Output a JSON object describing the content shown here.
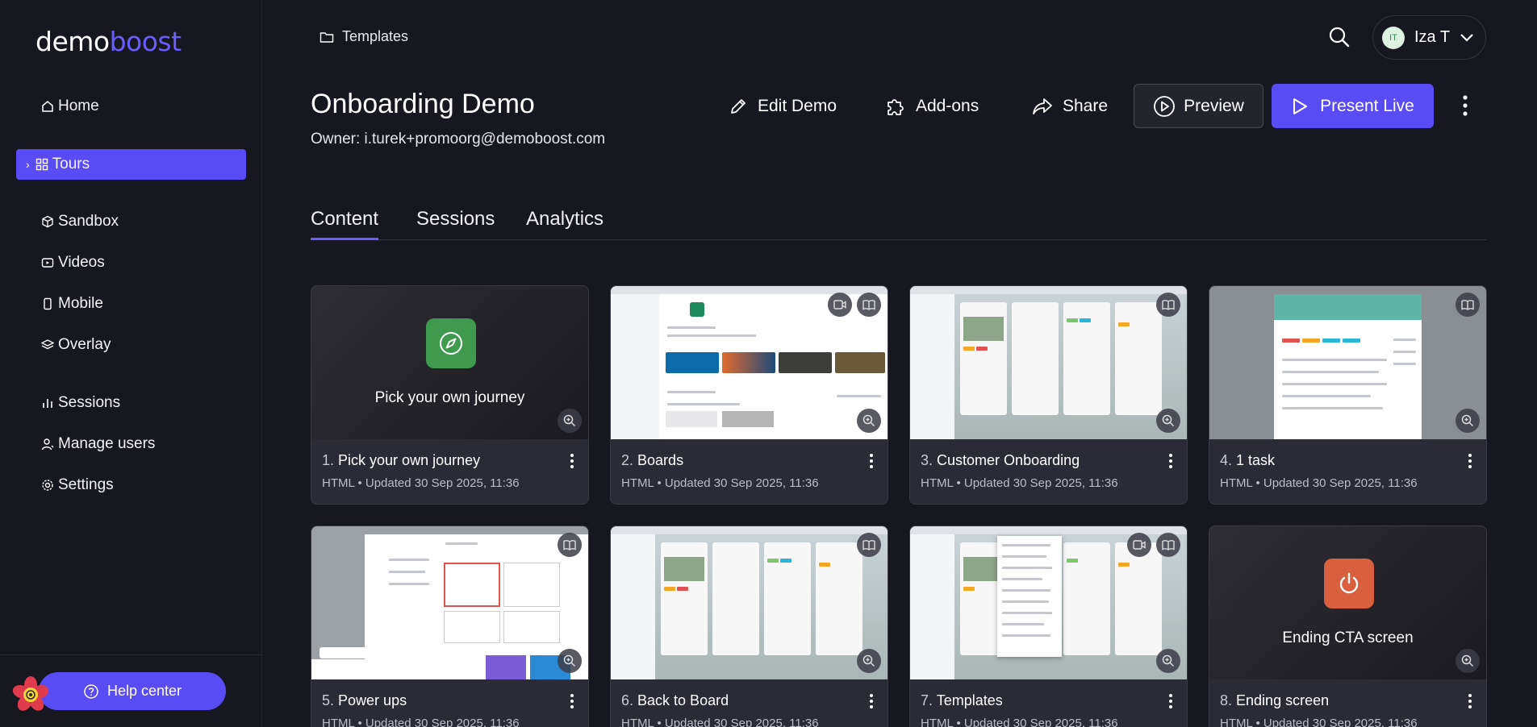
{
  "logo": {
    "part1": "demo",
    "part2": "boost"
  },
  "sidebar": {
    "items": [
      {
        "label": "Home",
        "icon": "home-icon"
      },
      {
        "label": "Tours",
        "icon": "grid-icon",
        "active": true
      },
      {
        "label": "Sandbox",
        "icon": "cube-icon"
      },
      {
        "label": "Videos",
        "icon": "video-icon"
      },
      {
        "label": "Mobile",
        "icon": "phone-icon"
      },
      {
        "label": "Overlay",
        "icon": "layers-icon"
      },
      {
        "label": "Sessions",
        "icon": "bar-chart-icon"
      },
      {
        "label": "Manage users",
        "icon": "user-icon"
      },
      {
        "label": "Settings",
        "icon": "gear-icon"
      }
    ],
    "help_label": "Help center"
  },
  "topbar": {
    "breadcrumb": "Templates",
    "user_initials": "IT",
    "user_name": "Iza T"
  },
  "header": {
    "title": "Onboarding Demo",
    "owner": "Owner: i.turek+promoorg@demoboost.com",
    "edit_label": "Edit Demo",
    "addons_label": "Add-ons",
    "share_label": "Share",
    "preview_label": "Preview",
    "present_label": "Present Live"
  },
  "tabs": [
    {
      "label": "Content",
      "active": true
    },
    {
      "label": "Sessions"
    },
    {
      "label": "Analytics"
    }
  ],
  "cards": [
    {
      "num": "1.",
      "title": "Pick your own journey",
      "sub": "HTML • Updated 30 Sep 2025, 11:36",
      "caption": "Pick your own journey"
    },
    {
      "num": "2.",
      "title": "Boards",
      "sub": "HTML • Updated 30 Sep 2025, 11:36"
    },
    {
      "num": "3.",
      "title": "Customer Onboarding",
      "sub": "HTML • Updated 30 Sep 2025, 11:36"
    },
    {
      "num": "4.",
      "title": "1 task",
      "sub": "HTML • Updated 30 Sep 2025, 11:36"
    },
    {
      "num": "5.",
      "title": "Power ups",
      "sub": "HTML • Updated 30 Sep 2025, 11:36"
    },
    {
      "num": "6.",
      "title": "Back to Board",
      "sub": "HTML • Updated 30 Sep 2025, 11:36"
    },
    {
      "num": "7.",
      "title": "Templates",
      "sub": "HTML • Updated 30 Sep 2025, 11:36"
    },
    {
      "num": "8.",
      "title": "Ending screen",
      "sub": "HTML • Updated 30 Sep 2025, 11:36",
      "caption": "Ending CTA screen"
    }
  ],
  "colors": {
    "accent": "#5a4cf5",
    "brand_boost": "#6a5cff",
    "journey_icon": "#3f9a4f",
    "ending_icon": "#d9603e"
  }
}
